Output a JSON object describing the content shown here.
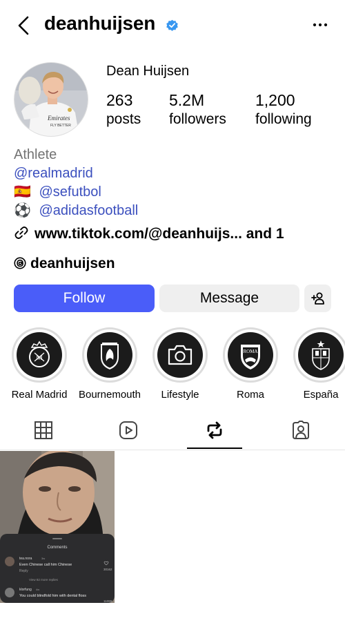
{
  "header": {
    "username": "deanhuijsen"
  },
  "profile": {
    "display_name": "Dean Huijsen",
    "stats": [
      {
        "value": "263",
        "label": "posts"
      },
      {
        "value": "5.2M",
        "label": "followers"
      },
      {
        "value": "1,200",
        "label": "following"
      }
    ],
    "avatar_shirt_text": "Emirates FLY BETTER"
  },
  "bio": {
    "category": "Athlete",
    "lines": [
      {
        "prefix": "",
        "text": "@realmadrid"
      },
      {
        "prefix": "🇪🇸",
        "text": "@sefutbol"
      },
      {
        "prefix": "⚽",
        "text": "@adidasfootball"
      }
    ],
    "link_text": "www.tiktok.com/@deanhuijs...  and 1",
    "threads_handle": "deanhuijsen"
  },
  "actions": {
    "follow_label": "Follow",
    "message_label": "Message"
  },
  "highlights": [
    {
      "label": "Real Madrid"
    },
    {
      "label": "Bournemouth"
    },
    {
      "label": "Lifestyle"
    },
    {
      "label": "Roma",
      "badge_text": "ROMA"
    },
    {
      "label": "España"
    }
  ],
  "tabs": {
    "active": "reposts"
  },
  "post": {
    "comments_header": "Comments",
    "comment1_user": "tea.nora",
    "comment1_time": "3w",
    "comment1_text": "Even Chinese call him Chinese",
    "comment1_reply": "Reply",
    "comment1_likes": "30162",
    "view_more": "View 82 more replies",
    "comment2_user": "klorfung",
    "comment2_time": "4w",
    "comment2_text": "You could blindfold him with dental floss",
    "comment2_likes": "11099"
  },
  "colors": {
    "follow_button": "#4a5df9",
    "mention": "#3b4fbe",
    "verified": "#3897f0"
  }
}
